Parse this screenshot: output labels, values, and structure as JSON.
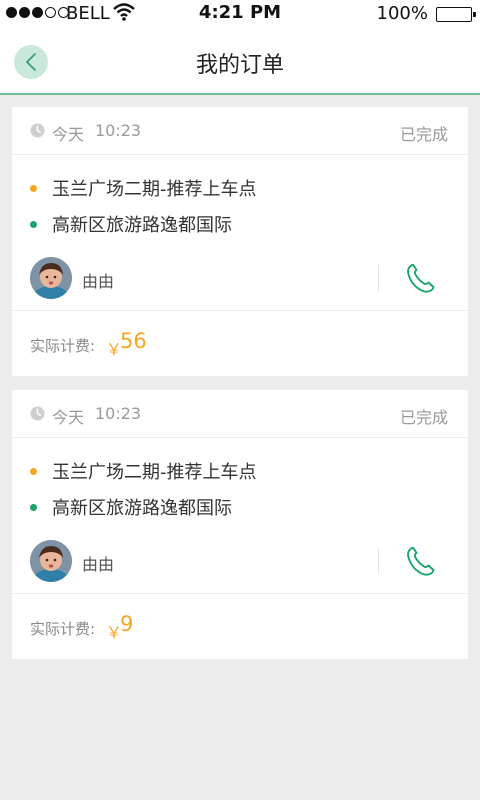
{
  "status_bar": {
    "carrier": "BELL",
    "time": "4:21 PM",
    "battery": "100%",
    "signal_bars": 3,
    "battery_level": 1.0
  },
  "header": {
    "title": "我的订单",
    "back_icon": "chevron-left-icon"
  },
  "colors": {
    "accent": "#6fbf9c",
    "start_dot": "#f5a623",
    "end_dot": "#1aa36a",
    "fee": "#f5a623"
  },
  "orders": [
    {
      "day": "今天",
      "time": "10:23",
      "status": "已完成",
      "from": "玉兰广场二期-推荐上车点",
      "to": "高新区旅游路逸都国际",
      "driver": "由由",
      "fee_label": "实际计费:",
      "currency": "￥",
      "fee": "56"
    },
    {
      "day": "今天",
      "time": "10:23",
      "status": "已完成",
      "from": "玉兰广场二期-推荐上车点",
      "to": "高新区旅游路逸都国际",
      "driver": "由由",
      "fee_label": "实际计费:",
      "currency": "￥",
      "fee": "9"
    }
  ]
}
